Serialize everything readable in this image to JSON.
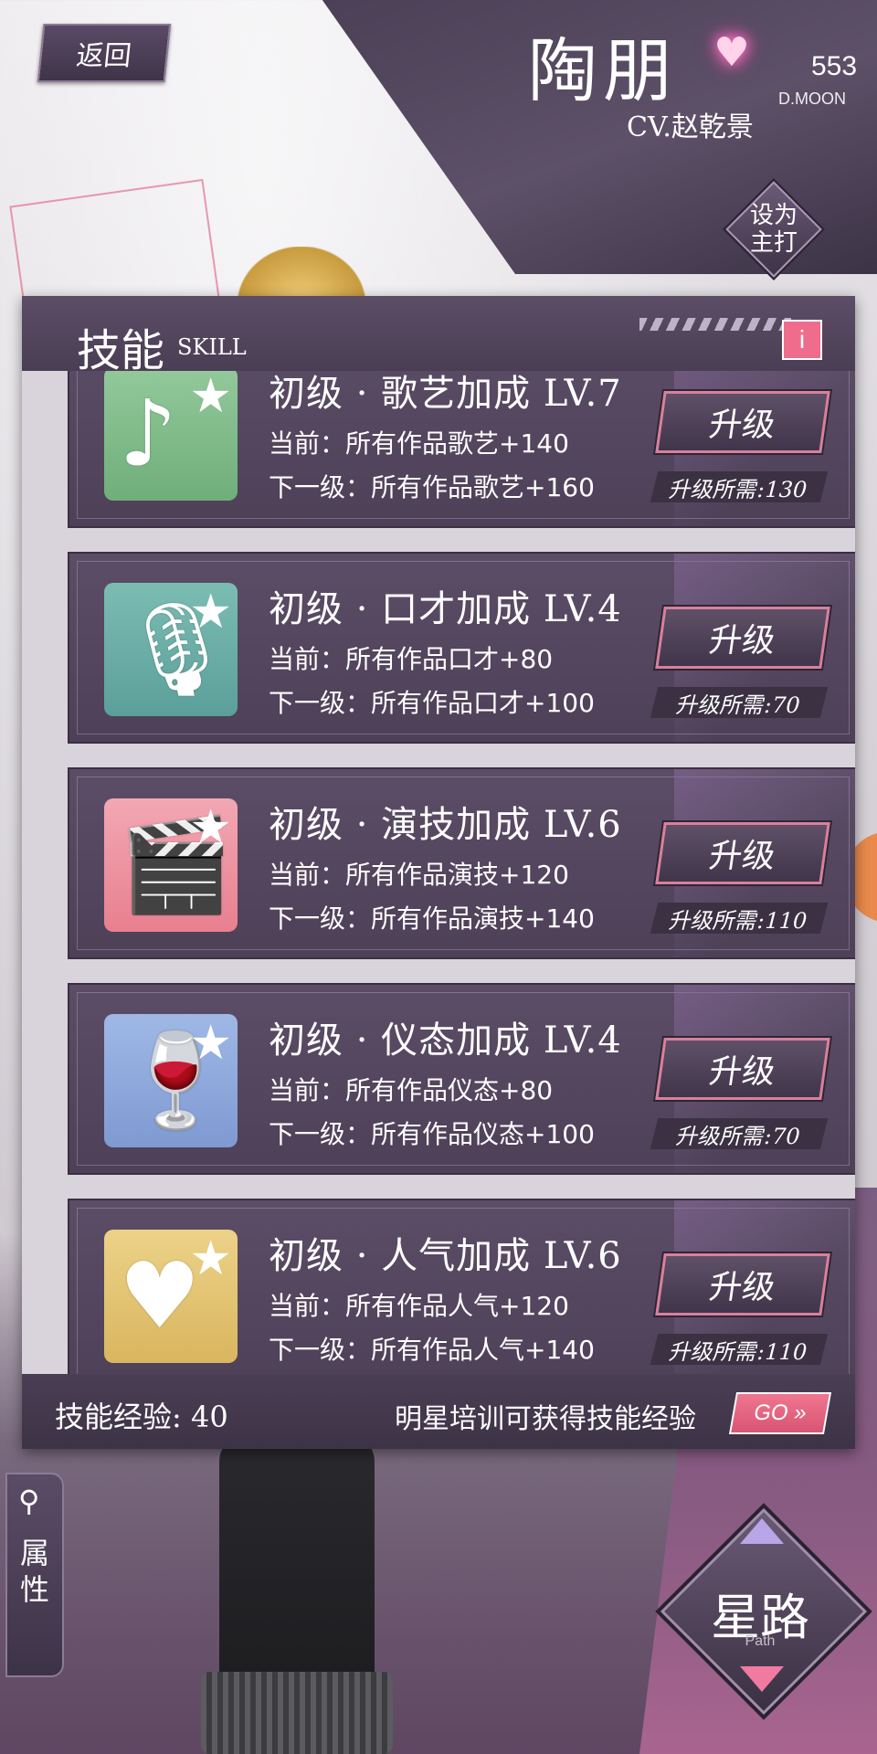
{
  "header": {
    "back_label": "返回",
    "character_name": "陶朋",
    "cv": "CV.赵乾景",
    "fan_count": "553",
    "fan_label": "D.MOON",
    "set_main_label": "设为主打"
  },
  "panel": {
    "title": "技能",
    "title_en": "SKILL",
    "info_label": "i",
    "skills": [
      {
        "name": "初级 · 歌艺加成 LV.7",
        "current": "当前：所有作品歌艺+140",
        "next": "下一级：所有作品歌艺+160",
        "upgrade_label": "升级",
        "cost": "升级所需:130",
        "icon": "guitar-icon",
        "color": "#7fb98a"
      },
      {
        "name": "初级 · 口才加成 LV.4",
        "current": "当前：所有作品口才+80",
        "next": "下一级：所有作品口才+100",
        "upgrade_label": "升级",
        "cost": "升级所需:70",
        "icon": "microphone-icon",
        "color": "#6fb0a8"
      },
      {
        "name": "初级 · 演技加成 LV.6",
        "current": "当前：所有作品演技+120",
        "next": "下一级：所有作品演技+140",
        "upgrade_label": "升级",
        "cost": "升级所需:110",
        "icon": "clapperboard-icon",
        "color": "#ee94a2"
      },
      {
        "name": "初级 · 仪态加成 LV.4",
        "current": "当前：所有作品仪态+80",
        "next": "下一级：所有作品仪态+100",
        "upgrade_label": "升级",
        "cost": "升级所需:70",
        "icon": "wine-glass-icon",
        "color": "#8fa9dc"
      },
      {
        "name": "初级 · 人气加成 LV.6",
        "current": "当前：所有作品人气+120",
        "next": "下一级：所有作品人气+140",
        "upgrade_label": "升级",
        "cost": "升级所需:110",
        "icon": "heart-icon",
        "color": "#e2c470"
      }
    ],
    "footer": {
      "exp_label": "技能经验: 40",
      "hint": "明星培训可获得技能经验",
      "go_label": "GO »"
    }
  },
  "side_tab": {
    "attr_label": "属性"
  },
  "star_road": {
    "label": "星路",
    "sub": "Path"
  },
  "colors": {
    "accent_pink": "#f06c8c",
    "panel_dark": "#4d4057"
  }
}
